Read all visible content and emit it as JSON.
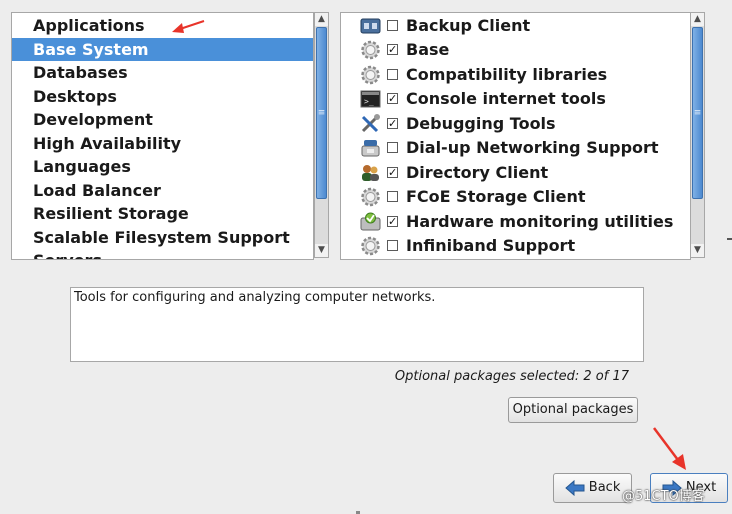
{
  "categories": {
    "items": [
      {
        "label": "Applications"
      },
      {
        "label": "Base System"
      },
      {
        "label": "Databases"
      },
      {
        "label": "Desktops"
      },
      {
        "label": "Development"
      },
      {
        "label": "High Availability"
      },
      {
        "label": "Languages"
      },
      {
        "label": "Load Balancer"
      },
      {
        "label": "Resilient Storage"
      },
      {
        "label": "Scalable Filesystem Support"
      },
      {
        "label": "Servers"
      }
    ],
    "selected": "Base System"
  },
  "packages": {
    "items": [
      {
        "label": "Backup Client",
        "checked": false,
        "icon": "backup-client-icon"
      },
      {
        "label": "Base",
        "checked": true,
        "icon": "gear-icon"
      },
      {
        "label": "Compatibility libraries",
        "checked": false,
        "icon": "gear-icon"
      },
      {
        "label": "Console internet tools",
        "checked": true,
        "icon": "terminal-icon"
      },
      {
        "label": "Debugging Tools",
        "checked": true,
        "icon": "tools-icon"
      },
      {
        "label": "Dial-up Networking Support",
        "checked": false,
        "icon": "phone-icon"
      },
      {
        "label": "Directory Client",
        "checked": true,
        "icon": "users-icon"
      },
      {
        "label": "FCoE Storage Client",
        "checked": false,
        "icon": "gear-icon"
      },
      {
        "label": "Hardware monitoring utilities",
        "checked": true,
        "icon": "hardware-monitor-icon"
      },
      {
        "label": "Infiniband Support",
        "checked": false,
        "icon": "gear-icon"
      }
    ]
  },
  "description": "Tools for configuring and analyzing computer networks.",
  "optional_selected": "Optional packages selected: 2 of 17",
  "buttons": {
    "optional": "Optional packages",
    "back": "Back",
    "next": "Next"
  },
  "watermark": "@51CTO博客",
  "colors": {
    "selection": "#4a90d9",
    "annotation_arrow": "#e8342a"
  }
}
